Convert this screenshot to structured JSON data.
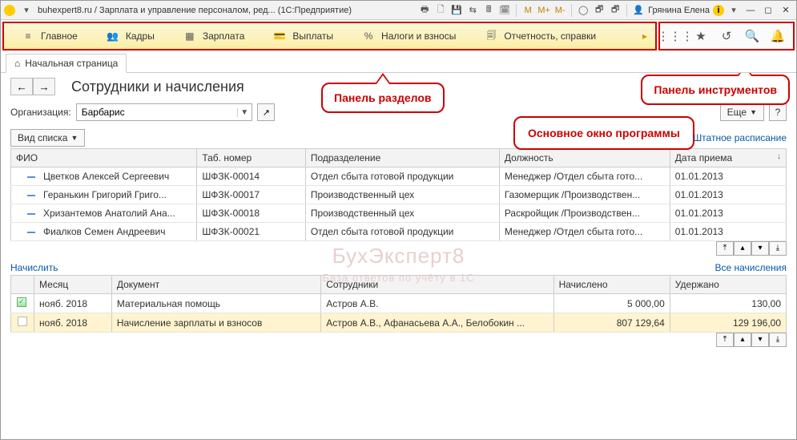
{
  "titlebar": {
    "text": "buhexpert8.ru / Зарплата и управление персоналом, ред...  (1С:Предприятие)",
    "user": "Грянина Елена",
    "markers": {
      "m": "M",
      "mplus": "M+",
      "mminus": "M-"
    },
    "info": "i"
  },
  "sections": {
    "items": [
      {
        "icon": "≡",
        "label": "Главное"
      },
      {
        "icon": "👥",
        "label": "Кадры"
      },
      {
        "icon": "▦",
        "label": "Зарплата"
      },
      {
        "icon": "💳",
        "label": "Выплаты"
      },
      {
        "icon": "%",
        "label": "Налоги и взносы"
      },
      {
        "icon": "🗐",
        "label": "Отчетность, справки"
      }
    ],
    "more": "▸"
  },
  "toolpanel_icons": [
    "⋮⋮⋮",
    "★",
    "↺",
    "🔍",
    "🔔"
  ],
  "crumb": {
    "home": "⌂",
    "label": "Начальная страница"
  },
  "page": {
    "title": "Сотрудники и начисления",
    "org_label": "Организация:",
    "org_value": "Барбарис",
    "more_btn": "Еще",
    "help": "?",
    "view_btn": "Вид списка",
    "staff_link": "Штатное расписание",
    "accrue_link": "Начислить",
    "all_link": "Все начисления"
  },
  "callouts": {
    "sections": "Панель разделов",
    "tools": "Панель инструментов",
    "main": "Основное окно программы"
  },
  "watermark": {
    "line1": "БухЭксперт8",
    "line2": "База ответов по учёту в 1С"
  },
  "grid1": {
    "cols": [
      "ФИО",
      "Таб. номер",
      "Подразделение",
      "Должность",
      "Дата приема"
    ],
    "sort_col": 4,
    "rows": [
      {
        "fio": "Цветков Алексей Сергеевич",
        "tab": "ШФЗК-00014",
        "dep": "Отдел сбыта готовой продукции",
        "pos": "Менеджер /Отдел сбыта гото...",
        "date": "01.01.2013"
      },
      {
        "fio": "Геранькин Григорий Григо...",
        "tab": "ШФЗК-00017",
        "dep": "Производственный цех",
        "pos": "Газомерщик /Производствен...",
        "date": "01.01.2013"
      },
      {
        "fio": "Хризантемов Анатолий Ана...",
        "tab": "ШФЗК-00018",
        "dep": "Производственный цех",
        "pos": "Раскройщик /Производствен...",
        "date": "01.01.2013"
      },
      {
        "fio": "Фиалков Семен Андреевич",
        "tab": "ШФЗК-00021",
        "dep": "Отдел сбыта готовой продукции",
        "pos": "Менеджер /Отдел сбыта гото...",
        "date": "01.01.2013"
      }
    ]
  },
  "grid2": {
    "cols": [
      "Месяц",
      "Документ",
      "Сотрудники",
      "Начислено",
      "Удержано"
    ],
    "rows": [
      {
        "posted": true,
        "month": "нояб. 2018",
        "doc": "Материальная помощь",
        "emp": "Астров А.В.",
        "acc": "5 000,00",
        "hold": "130,00",
        "hl": false
      },
      {
        "posted": false,
        "month": "нояб. 2018",
        "doc": "Начисление зарплаты и взносов",
        "emp": "Астров А.В., Афанасьева А.А., Белобокин ...",
        "acc": "807 129,64",
        "hold": "129 196,00",
        "hl": true
      }
    ]
  },
  "scroll_icons": [
    "⤒",
    "▴",
    "▾",
    "⤓"
  ]
}
